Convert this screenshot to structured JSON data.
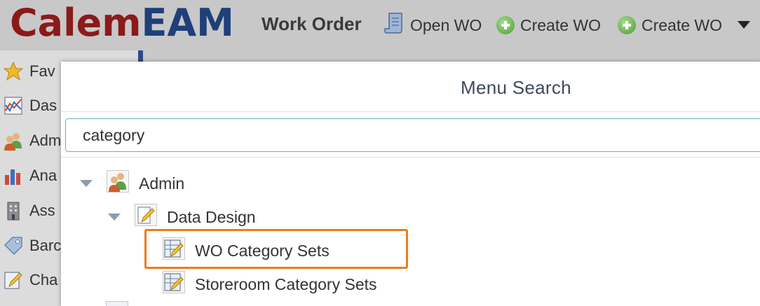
{
  "header": {
    "logo_part1": "Calem",
    "logo_part2": "EAM",
    "module_title": "Work Order",
    "buttons": [
      {
        "label": "Open WO",
        "icon": "document-icon"
      },
      {
        "label": "Create WO",
        "icon": "add-icon"
      },
      {
        "label": "Create WO",
        "icon": "add-icon"
      }
    ],
    "menu_icon": "chevron-down-icon"
  },
  "sidebar": {
    "items": [
      {
        "label": "Fav",
        "icon": "star-icon"
      },
      {
        "label": "Das",
        "icon": "chart-line-icon"
      },
      {
        "label": "Adm",
        "icon": "users-icon"
      },
      {
        "label": "Ana",
        "icon": "bar-chart-icon"
      },
      {
        "label": "Ass",
        "icon": "building-icon"
      },
      {
        "label": "Barc",
        "icon": "tag-icon"
      },
      {
        "label": "Cha",
        "icon": "edit-icon"
      }
    ]
  },
  "menu_search": {
    "title": "Menu Search",
    "query": "category",
    "tree": {
      "root": {
        "label": "Admin",
        "icon": "users-icon",
        "expanded": true
      },
      "child": {
        "label": "Data Design",
        "icon": "edit-document-icon",
        "expanded": true
      },
      "leaves": [
        {
          "label": "WO Category Sets",
          "icon": "edit-table-icon",
          "highlighted": true
        },
        {
          "label": "Storeroom Category Sets",
          "icon": "edit-table-icon",
          "highlighted": false
        }
      ]
    }
  },
  "colors": {
    "logo_calem": "#8b1a1a",
    "logo_eam": "#1f3f7a",
    "highlight_border": "#ef7b1a",
    "search_border": "#6aa7cf"
  }
}
